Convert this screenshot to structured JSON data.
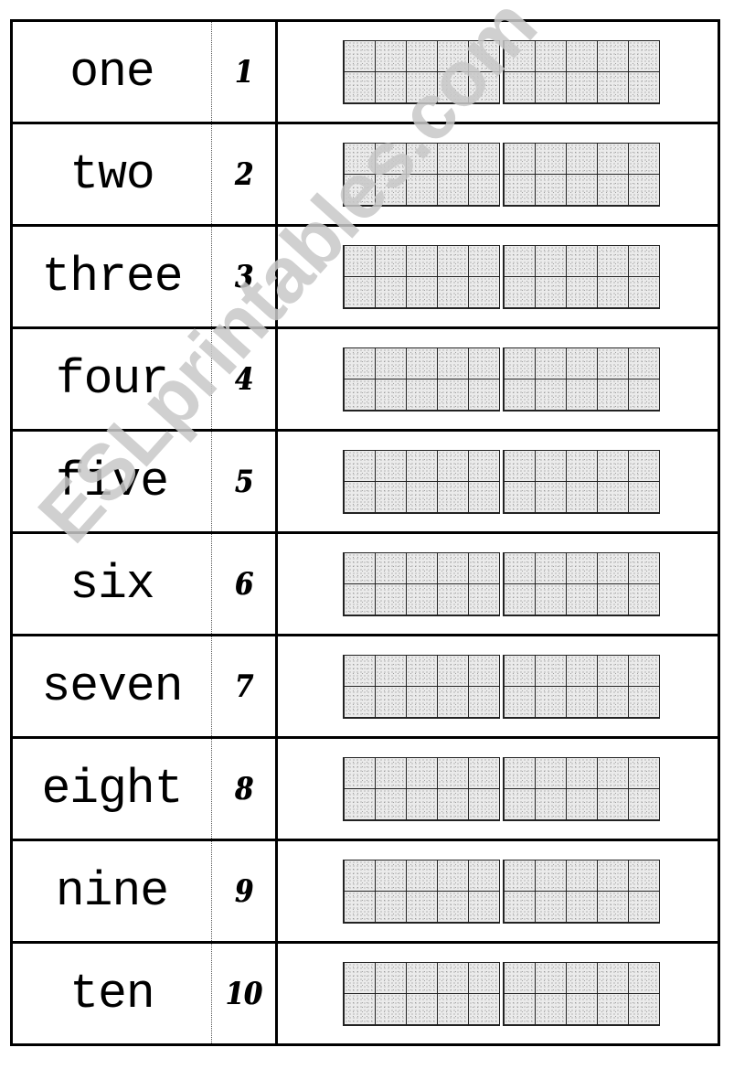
{
  "worksheet": {
    "rows": [
      {
        "word": "one",
        "digit": "1",
        "ten_frames": 2,
        "filled_cells": 0
      },
      {
        "word": "two",
        "digit": "2",
        "ten_frames": 2,
        "filled_cells": 0
      },
      {
        "word": "three",
        "digit": "3",
        "ten_frames": 2,
        "filled_cells": 0
      },
      {
        "word": "four",
        "digit": "4",
        "ten_frames": 2,
        "filled_cells": 0
      },
      {
        "word": "five",
        "digit": "5",
        "ten_frames": 2,
        "filled_cells": 0
      },
      {
        "word": "six",
        "digit": "6",
        "ten_frames": 2,
        "filled_cells": 0
      },
      {
        "word": "seven",
        "digit": "7",
        "ten_frames": 2,
        "filled_cells": 0
      },
      {
        "word": "eight",
        "digit": "8",
        "ten_frames": 2,
        "filled_cells": 0
      },
      {
        "word": "nine",
        "digit": "9",
        "ten_frames": 2,
        "filled_cells": 0
      },
      {
        "word": "ten",
        "digit": "10",
        "ten_frames": 2,
        "filled_cells": 0
      }
    ]
  },
  "watermark": {
    "text": "ESLprintables.com",
    "color": "#c8c8c8"
  },
  "colors": {
    "border": "#000000",
    "cell_fill": "#ebebeb"
  }
}
